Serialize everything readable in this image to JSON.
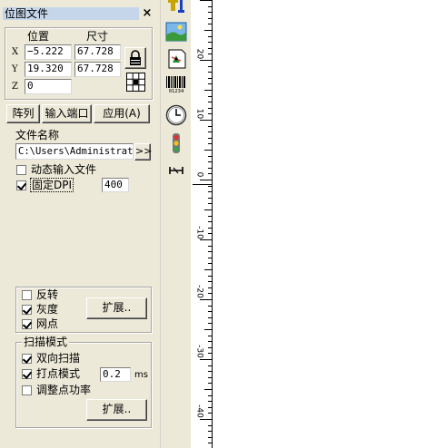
{
  "panel": {
    "title": "位图文件",
    "close_glyph": "×",
    "position_header": "位置",
    "size_header": "尺寸",
    "rows": [
      {
        "axis": "X",
        "position": "−5.222",
        "size": "67.728"
      },
      {
        "axis": "Y",
        "position": "19.320",
        "size": "67.728"
      },
      {
        "axis": "Z",
        "position": "0"
      }
    ],
    "buttons": {
      "array": "阵列",
      "input_port": "输入端口",
      "apply": "应用(A)"
    },
    "file": {
      "label": "文件名称",
      "path": "C:\\Users\\Administrato",
      "browse": ">>"
    },
    "dynamic_input": {
      "label": "动态输入文件",
      "checked": false
    },
    "fixed_dpi": {
      "label": "固定DPI",
      "checked": true,
      "value": "400"
    },
    "image_options": [
      {
        "label": "反转",
        "checked": false
      },
      {
        "label": "灰度",
        "checked": true
      },
      {
        "label": "网点",
        "checked": true
      }
    ],
    "expand1": "扩展..",
    "scan_mode": {
      "title": "扫描模式",
      "bidirectional": {
        "label": "双向扫描",
        "checked": true
      },
      "dot_mode": {
        "label": "打点模式",
        "checked": true,
        "value": "0.2",
        "unit": "ms"
      },
      "adjust_power": {
        "label": "调整点功率",
        "checked": false
      },
      "expand": "扩展.."
    }
  },
  "toolbar": {
    "icons": [
      "text-tool-icon",
      "bitmap-icon",
      "vector-import-icon",
      "barcode-icon",
      "timer-icon",
      "traffic-light-icon",
      "extension-axis-icon"
    ],
    "barcode_digits": "01234"
  },
  "ruler": {
    "labels": [
      "20",
      "10",
      "0",
      "-10",
      "-20",
      "-30",
      "-40"
    ]
  }
}
